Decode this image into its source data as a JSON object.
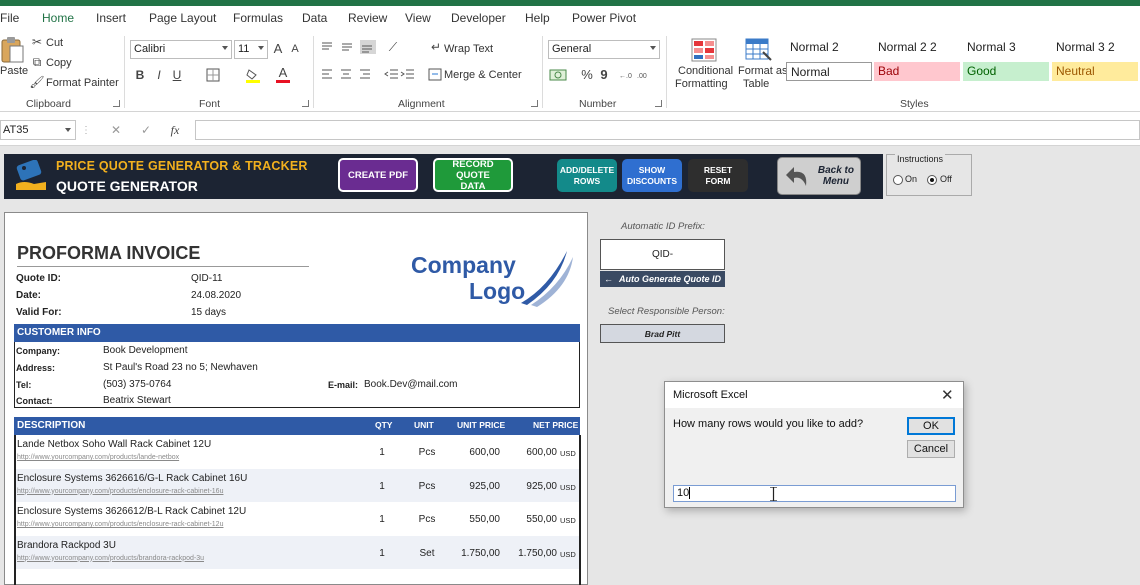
{
  "ribbon_tabs": [
    "File",
    "Home",
    "Insert",
    "Page Layout",
    "Formulas",
    "Data",
    "Review",
    "View",
    "Developer",
    "Help",
    "Power Pivot"
  ],
  "clipboard": {
    "paste": "Paste",
    "cut": "Cut",
    "copy": "Copy",
    "format_painter": "Format Painter",
    "group": "Clipboard"
  },
  "font": {
    "name": "Calibri",
    "size": "11",
    "bold": "B",
    "italic": "I",
    "underline": "U",
    "grow": "A",
    "shrink": "A",
    "color_letter": "A",
    "group": "Font"
  },
  "alignment": {
    "wrap_text": "Wrap Text",
    "merge_center": "Merge & Center",
    "group": "Alignment"
  },
  "number": {
    "format": "General",
    "percent": "%",
    "comma": "9",
    "group": "Number"
  },
  "styles": {
    "conditional_formatting": [
      "Conditional",
      "Formatting"
    ],
    "format_as_table": [
      "Format as",
      "Table"
    ],
    "cells": [
      {
        "label": "Normal 2",
        "bg": "#ffffff"
      },
      {
        "label": "Normal 2 2",
        "bg": "#ffffff"
      },
      {
        "label": "Normal 3",
        "bg": "#ffffff"
      },
      {
        "label": "Normal 3 2",
        "bg": "#ffffff"
      },
      {
        "label": "Normal",
        "bg": "#ffffff"
      },
      {
        "label": "Bad",
        "bg": "#ffc7ce",
        "color": "#9c0006"
      },
      {
        "label": "Good",
        "bg": "#c6efce",
        "color": "#006100"
      },
      {
        "label": "Neutral",
        "bg": "#ffeb9c",
        "color": "#9c5700"
      }
    ],
    "group": "Styles"
  },
  "formula_bar": {
    "name_box": "AT35",
    "fx": "fx",
    "cancel": "✕",
    "enter": "✓"
  },
  "banner": {
    "title": "PRICE QUOTE GENERATOR & TRACKER",
    "subtitle": "QUOTE GENERATOR",
    "create_pdf": "CREATE PDF",
    "record_quote": [
      "RECORD QUOTE",
      "DATA"
    ],
    "add_delete_rows": [
      "ADD/DELETE",
      "ROWS"
    ],
    "show_discounts": [
      "SHOW",
      "DISCOUNTS"
    ],
    "reset_form": [
      "RESET",
      "FORM"
    ],
    "back_to_menu": [
      "Back to",
      "Menu"
    ]
  },
  "instructions": {
    "title": "Instructions",
    "on": "On",
    "off": "Off"
  },
  "invoice": {
    "title": "PROFORMA INVOICE",
    "logo": [
      "Company",
      "Logo"
    ],
    "quote_id_label": "Quote ID:",
    "quote_id": "QID-11",
    "date_label": "Date:",
    "date": "24.08.2020",
    "valid_label": "Valid For:",
    "valid": "15 days",
    "customer_head": "CUSTOMER INFO",
    "company_label": "Company:",
    "company": "Book Development",
    "address_label": "Address:",
    "address": "St Paul's Road 23 no 5; Newhaven",
    "tel_label": "Tel:",
    "tel": "(503) 375-0764",
    "email_label": "E-mail:",
    "email": "Book.Dev@mail.com",
    "contact_label": "Contact:",
    "contact": "Beatrix Stewart",
    "columns": {
      "description": "DESCRIPTION",
      "qty": "QTY",
      "unit": "UNIT",
      "unit_price": "UNIT PRICE",
      "net_price": "NET PRICE"
    },
    "items": [
      {
        "desc": "Lande Netbox Soho Wall Rack Cabinet 12U",
        "link": "http://www.yourcompany.com/products/lande-netbox",
        "qty": "1",
        "unit": "Pcs",
        "price": "600,00",
        "net": "600,00",
        "cur": "USD"
      },
      {
        "desc": "Enclosure Systems 3626616/G-L Rack Cabinet 16U",
        "link": "http://www.yourcompany.com/products/enclosure-rack-cabinet-16u",
        "qty": "1",
        "unit": "Pcs",
        "price": "925,00",
        "net": "925,00",
        "cur": "USD"
      },
      {
        "desc": "Enclosure Systems 3626612/B-L Rack Cabinet 12U",
        "link": "http://www.yourcompany.com/products/enclosure-rack-cabinet-12u",
        "qty": "1",
        "unit": "Pcs",
        "price": "550,00",
        "net": "550,00",
        "cur": "USD"
      },
      {
        "desc": "Brandora Rackpod 3U",
        "link": "http://www.yourcompany.com/products/brandora-rackpod-3u",
        "qty": "1",
        "unit": "Set",
        "price": "1.750,00",
        "net": "1.750,00",
        "cur": "USD"
      }
    ]
  },
  "side": {
    "prefix_label": "Automatic ID Prefix:",
    "prefix_value": "QID-",
    "auto_generate": "Auto Generate Quote ID",
    "person_label": "Select Responsible Person:",
    "person_value": "Brad Pitt"
  },
  "dialog": {
    "title": "Microsoft Excel",
    "close": "✕",
    "prompt": "How many rows would you like to add?",
    "ok": "OK",
    "cancel": "Cancel",
    "input_value": "10"
  }
}
